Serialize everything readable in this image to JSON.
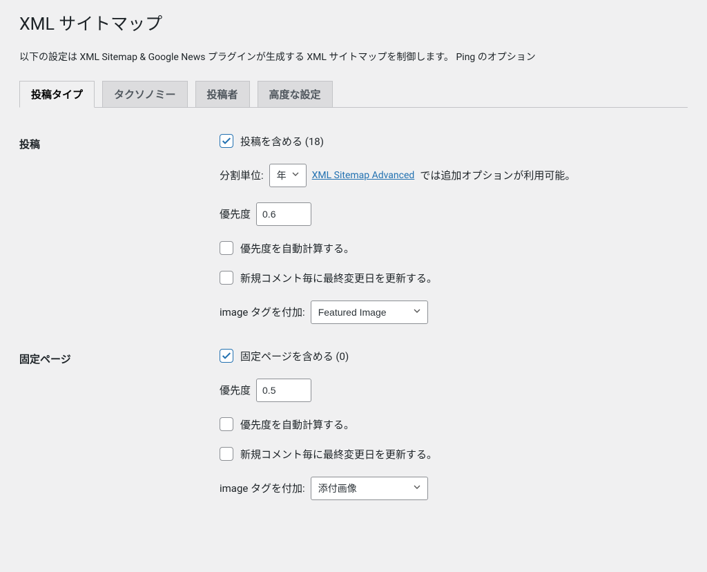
{
  "page_title": "XML サイトマップ",
  "description": "以下の設定は XML Sitemap & Google News プラグインが生成する XML サイトマップを制御します。 Ping のオプション",
  "tabs": [
    {
      "label": "投稿タイプ",
      "active": true
    },
    {
      "label": "タクソノミー",
      "active": false
    },
    {
      "label": "投稿者",
      "active": false
    },
    {
      "label": "高度な設定",
      "active": false
    }
  ],
  "sections": {
    "posts": {
      "heading": "投稿",
      "include_label": "投稿を含める (18)",
      "include_checked": true,
      "split_label": "分割単位:",
      "split_value": "年",
      "advanced_link_text": "XML Sitemap Advanced",
      "advanced_after": " では追加オプションが利用可能。",
      "priority_label": "優先度",
      "priority_value": "0.6",
      "auto_priority_label": "優先度を自動計算する。",
      "auto_priority_checked": false,
      "update_lastmod_label": "新規コメント毎に最終変更日を更新する。",
      "update_lastmod_checked": false,
      "image_tag_label": "image タグを付加:",
      "image_tag_value": "Featured Image"
    },
    "pages": {
      "heading": "固定ページ",
      "include_label": "固定ページを含める (0)",
      "include_checked": true,
      "priority_label": "優先度",
      "priority_value": "0.5",
      "auto_priority_label": "優先度を自動計算する。",
      "auto_priority_checked": false,
      "update_lastmod_label": "新規コメント毎に最終変更日を更新する。",
      "update_lastmod_checked": false,
      "image_tag_label": "image タグを付加:",
      "image_tag_value": "添付画像"
    }
  }
}
